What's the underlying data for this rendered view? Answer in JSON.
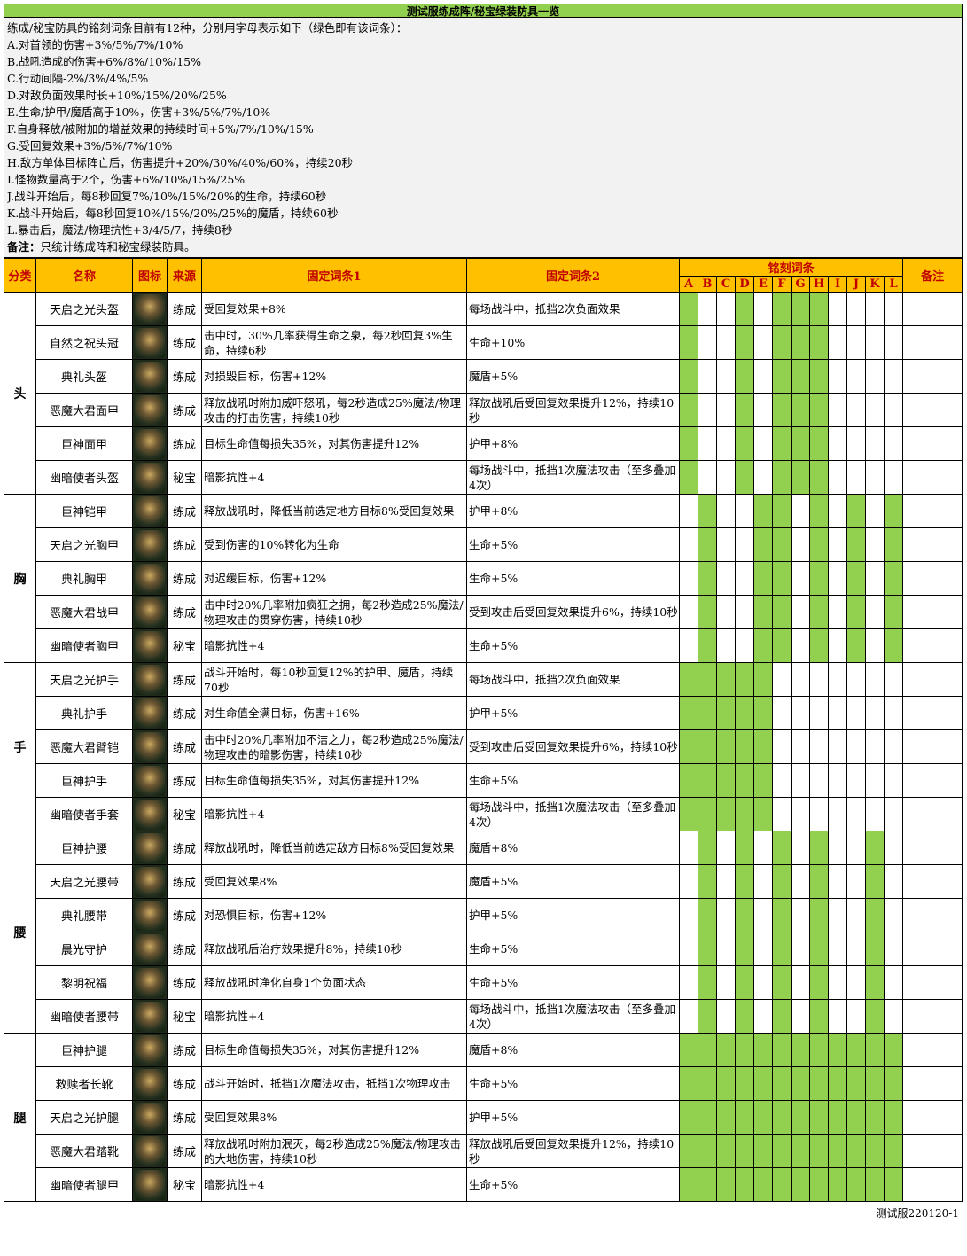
{
  "title": "测试服练成阵/秘宝绿装防具一览",
  "intro": [
    "练成/秘宝防具的铭刻词条目前有12种，分别用字母表示如下（绿色即有该词条）：",
    "A.对首领的伤害+3%/5%/7%/10%",
    "B.战吼造成的伤害+6%/8%/10%/15%",
    "C.行动间隔-2%/3%/4%/5%",
    "D.对敌负面效果时长+10%/15%/20%/25%",
    "E.生命/护甲/魔盾高于10%，伤害+3%/5%/7%/10%",
    "F.自身释放/被附加的增益效果的持续时间+5%/7%/10%/15%",
    "G.受回复效果+3%/5%/7%/10%",
    "H.敌方单体目标阵亡后，伤害提升+20%/30%/40%/60%，持续20秒",
    "I.怪物数量高于2个，伤害+6%/10%/15%/25%",
    "J.战斗开始后，每8秒回复7%/10%/15%/20%的生命，持续60秒",
    "K.战斗开始后，每8秒回复10%/15%/20%/25%的魔盾，持续60秒",
    "L.暴击后，魔法/物理抗性+3/4/5/7，持续8秒"
  ],
  "note_label": "备注：",
  "note_text": "只统计练成阵和秘宝绿装防具。",
  "headers": {
    "category": "分类",
    "name": "名称",
    "icon": "图标",
    "source": "来源",
    "fixed1": "固定词条1",
    "fixed2": "固定词条2",
    "inscriptions": "铭刻词条",
    "remarks": "备注"
  },
  "letters": [
    "A",
    "B",
    "C",
    "D",
    "E",
    "F",
    "G",
    "H",
    "I",
    "J",
    "K",
    "L"
  ],
  "colors": {
    "title_bg": "#92d050",
    "header_bg": "#ffc000",
    "header_text": "#c00000",
    "flag_on": "#92d050",
    "intro_bg": "#f2f2f2"
  },
  "groups": [
    {
      "category": "头",
      "items": [
        {
          "name": "天启之光头盔",
          "source": "练成",
          "fixed1": "受回复效果+8%",
          "fixed2": "每场战斗中，抵挡2次负面效果",
          "flags": "100101110000"
        },
        {
          "name": "自然之祝头冠",
          "source": "练成",
          "fixed1": "击中时，30%几率获得生命之泉，每2秒回复3%生命，持续6秒",
          "fixed2": "生命+10%",
          "flags": "100101110000"
        },
        {
          "name": "典礼头盔",
          "source": "练成",
          "fixed1": "对损毁目标，伤害+12%",
          "fixed2": "魔盾+5%",
          "flags": "100101110000"
        },
        {
          "name": "恶魔大君面甲",
          "source": "练成",
          "fixed1": "释放战吼时附加威吓怒吼，每2秒造成25%魔法/物理攻击的打击伤害，持续10秒",
          "fixed2": "释放战吼后受回复效果提升12%，持续10秒",
          "flags": "100101110000"
        },
        {
          "name": "巨神面甲",
          "source": "练成",
          "fixed1": "目标生命值每损失35%，对其伤害提升12%",
          "fixed2": "护甲+8%",
          "flags": "100101110000"
        },
        {
          "name": "幽暗使者头盔",
          "source": "秘宝",
          "fixed1": "暗影抗性+4",
          "fixed2": "每场战斗中，抵挡1次魔法攻击（至多叠加4次）",
          "flags": "100101110000"
        }
      ]
    },
    {
      "category": "胸",
      "items": [
        {
          "name": "巨神铠甲",
          "source": "练成",
          "fixed1": "释放战吼时，降低当前选定地方目标8%受回复效果",
          "fixed2": "护甲+8%",
          "flags": "010011010101"
        },
        {
          "name": "天启之光胸甲",
          "source": "练成",
          "fixed1": "受到伤害的10%转化为生命",
          "fixed2": "生命+5%",
          "flags": "010011010101"
        },
        {
          "name": "典礼胸甲",
          "source": "练成",
          "fixed1": "对迟缓目标，伤害+12%",
          "fixed2": "生命+5%",
          "flags": "010011010101"
        },
        {
          "name": "恶魔大君战甲",
          "source": "练成",
          "fixed1": "击中时20%几率附加疯狂之拥，每2秒造成25%魔法/物理攻击的贯穿伤害，持续10秒",
          "fixed2": "受到攻击后受回复效果提升6%，持续10秒",
          "flags": "010011010101"
        },
        {
          "name": "幽暗使者胸甲",
          "source": "秘宝",
          "fixed1": "暗影抗性+4",
          "fixed2": "生命+5%",
          "flags": "010011010101"
        }
      ]
    },
    {
      "category": "手",
      "items": [
        {
          "name": "天启之光护手",
          "source": "练成",
          "fixed1": "战斗开始时，每10秒回复12%的护甲、魔盾，持续70秒",
          "fixed2": "每场战斗中，抵挡2次负面效果",
          "flags": "111110000000"
        },
        {
          "name": "典礼护手",
          "source": "练成",
          "fixed1": "对生命值全满目标，伤害+16%",
          "fixed2": "护甲+5%",
          "flags": "111110000000"
        },
        {
          "name": "恶魔大君臂铠",
          "source": "练成",
          "fixed1": "击中时20%几率附加不洁之力，每2秒造成25%魔法/物理攻击的暗影伤害，持续10秒",
          "fixed2": "受到攻击后受回复效果提升6%，持续10秒",
          "flags": "111110000000"
        },
        {
          "name": "巨神护手",
          "source": "练成",
          "fixed1": "目标生命值每损失35%，对其伤害提升12%",
          "fixed2": "生命+5%",
          "flags": "111110000000"
        },
        {
          "name": "幽暗使者手套",
          "source": "秘宝",
          "fixed1": "暗影抗性+4",
          "fixed2": "每场战斗中，抵挡1次魔法攻击（至多叠加4次）",
          "flags": "111110000000"
        }
      ]
    },
    {
      "category": "腰",
      "items": [
        {
          "name": "巨神护腰",
          "source": "练成",
          "fixed1": "释放战吼时，降低当前选定敌方目标8%受回复效果",
          "fixed2": "魔盾+8%",
          "flags": "010101010010"
        },
        {
          "name": "天启之光腰带",
          "source": "练成",
          "fixed1": "受回复效果8%",
          "fixed2": "魔盾+5%",
          "flags": "010101010010"
        },
        {
          "name": "典礼腰带",
          "source": "练成",
          "fixed1": "对恐惧目标，伤害+12%",
          "fixed2": "护甲+5%",
          "flags": "010101010010"
        },
        {
          "name": "晨光守护",
          "source": "练成",
          "fixed1": "释放战吼后治疗效果提升8%，持续10秒",
          "fixed2": "生命+5%",
          "flags": "010101010010"
        },
        {
          "name": "黎明祝福",
          "source": "练成",
          "fixed1": "释放战吼时净化自身1个负面状态",
          "fixed2": "生命+5%",
          "flags": "010101010010"
        },
        {
          "name": "幽暗使者腰带",
          "source": "秘宝",
          "fixed1": "暗影抗性+4",
          "fixed2": "每场战斗中，抵挡1次魔法攻击（至多叠加4次）",
          "flags": "010101010010"
        }
      ]
    },
    {
      "category": "腿",
      "items": [
        {
          "name": "巨神护腿",
          "source": "练成",
          "fixed1": "目标生命值每损失35%，对其伤害提升12%",
          "fixed2": "魔盾+8%",
          "flags": "111111111111"
        },
        {
          "name": "救赎者长靴",
          "source": "练成",
          "fixed1": "战斗开始时，抵挡1次魔法攻击，抵挡1次物理攻击",
          "fixed2": "生命+5%",
          "flags": "111111111111"
        },
        {
          "name": "天启之光护腿",
          "source": "练成",
          "fixed1": "受回复效果8%",
          "fixed2": "护甲+5%",
          "flags": "111111111111"
        },
        {
          "name": "恶魔大君踏靴",
          "source": "练成",
          "fixed1": "释放战吼时附加泯灭，每2秒造成25%魔法/物理攻击的大地伤害，持续10秒",
          "fixed2": "释放战吼后受回复效果提升12%，持续10秒",
          "flags": "111111111111"
        },
        {
          "name": "幽暗使者腿甲",
          "source": "秘宝",
          "fixed1": "暗影抗性+4",
          "fixed2": "生命+5%",
          "flags": "111111111111"
        }
      ]
    }
  ],
  "footer": "测试服220120-1"
}
